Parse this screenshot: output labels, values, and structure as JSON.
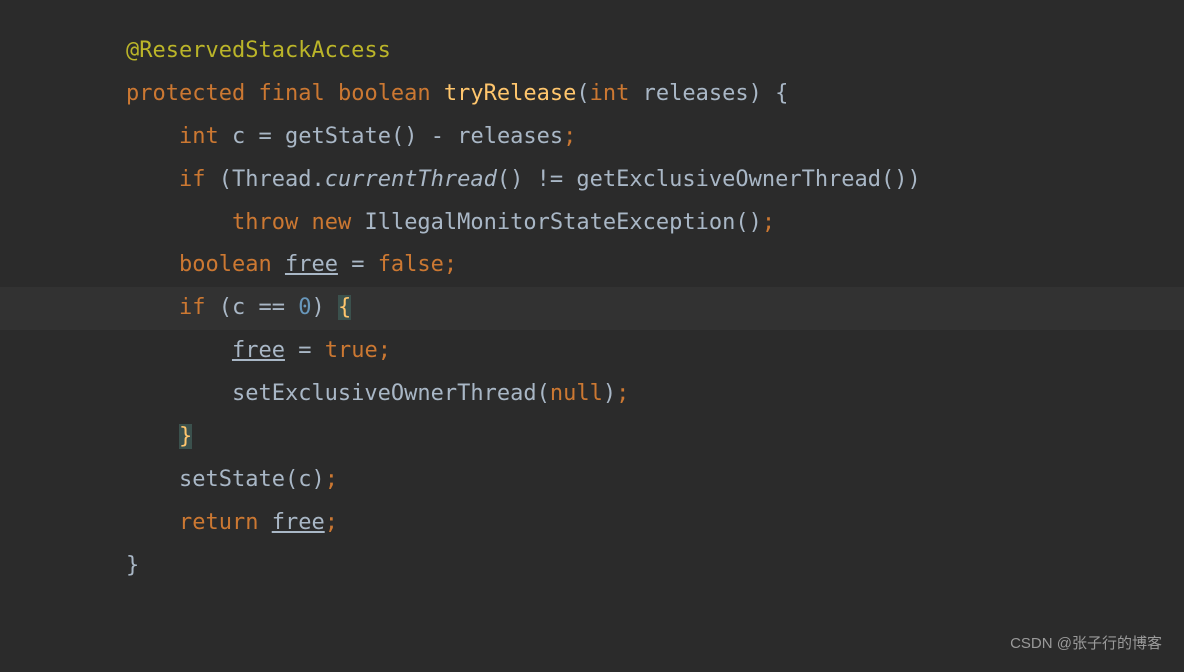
{
  "code": {
    "annotation": "@ReservedStackAccess",
    "modifiers": {
      "protected": "protected",
      "final": "final",
      "boolean": "boolean"
    },
    "method_name": "tryRelease",
    "param_type": "int",
    "param_name": "releases",
    "line3": {
      "int": "int",
      "c": "c",
      "eq": "=",
      "getState": "getState",
      "minus": "-",
      "releases": "releases"
    },
    "line4": {
      "if": "if",
      "Thread": "Thread",
      "currentThread": "currentThread",
      "neq": "!=",
      "getExclusiveOwnerThread": "getExclusiveOwnerThread"
    },
    "line5": {
      "throw": "throw",
      "new": "new",
      "IllegalMonitorStateException": "IllegalMonitorStateException"
    },
    "line6": {
      "boolean": "boolean",
      "free": "free",
      "eq": "=",
      "false": "false"
    },
    "line7": {
      "if": "if",
      "c": "c",
      "eqeq": "==",
      "zero": "0"
    },
    "line8": {
      "free": "free",
      "eq": "=",
      "true": "true"
    },
    "line9": {
      "setExclusiveOwnerThread": "setExclusiveOwnerThread",
      "null": "null"
    },
    "line11": {
      "setState": "setState",
      "c": "c"
    },
    "line12": {
      "return": "return",
      "free": "free"
    }
  },
  "watermark": "CSDN @张子行的博客"
}
